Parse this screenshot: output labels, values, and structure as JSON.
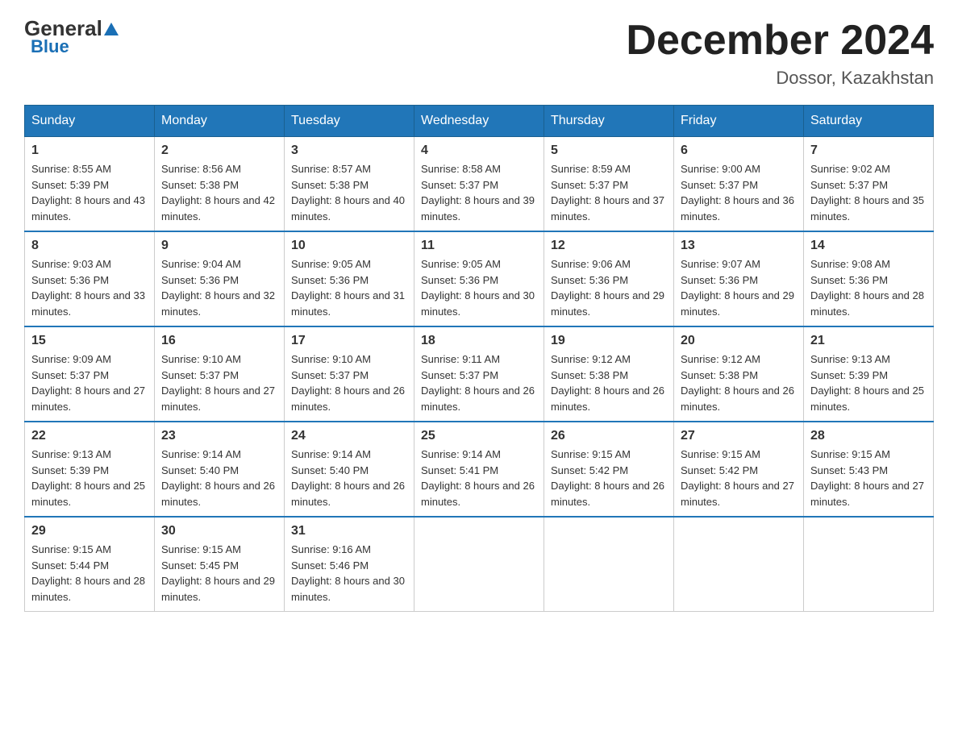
{
  "header": {
    "logo_general": "General",
    "logo_blue": "Blue",
    "month_title": "December 2024",
    "location": "Dossor, Kazakhstan"
  },
  "weekdays": [
    "Sunday",
    "Monday",
    "Tuesday",
    "Wednesday",
    "Thursday",
    "Friday",
    "Saturday"
  ],
  "weeks": [
    [
      {
        "day": "1",
        "sunrise": "8:55 AM",
        "sunset": "5:39 PM",
        "daylight": "8 hours and 43 minutes."
      },
      {
        "day": "2",
        "sunrise": "8:56 AM",
        "sunset": "5:38 PM",
        "daylight": "8 hours and 42 minutes."
      },
      {
        "day": "3",
        "sunrise": "8:57 AM",
        "sunset": "5:38 PM",
        "daylight": "8 hours and 40 minutes."
      },
      {
        "day": "4",
        "sunrise": "8:58 AM",
        "sunset": "5:37 PM",
        "daylight": "8 hours and 39 minutes."
      },
      {
        "day": "5",
        "sunrise": "8:59 AM",
        "sunset": "5:37 PM",
        "daylight": "8 hours and 37 minutes."
      },
      {
        "day": "6",
        "sunrise": "9:00 AM",
        "sunset": "5:37 PM",
        "daylight": "8 hours and 36 minutes."
      },
      {
        "day": "7",
        "sunrise": "9:02 AM",
        "sunset": "5:37 PM",
        "daylight": "8 hours and 35 minutes."
      }
    ],
    [
      {
        "day": "8",
        "sunrise": "9:03 AM",
        "sunset": "5:36 PM",
        "daylight": "8 hours and 33 minutes."
      },
      {
        "day": "9",
        "sunrise": "9:04 AM",
        "sunset": "5:36 PM",
        "daylight": "8 hours and 32 minutes."
      },
      {
        "day": "10",
        "sunrise": "9:05 AM",
        "sunset": "5:36 PM",
        "daylight": "8 hours and 31 minutes."
      },
      {
        "day": "11",
        "sunrise": "9:05 AM",
        "sunset": "5:36 PM",
        "daylight": "8 hours and 30 minutes."
      },
      {
        "day": "12",
        "sunrise": "9:06 AM",
        "sunset": "5:36 PM",
        "daylight": "8 hours and 29 minutes."
      },
      {
        "day": "13",
        "sunrise": "9:07 AM",
        "sunset": "5:36 PM",
        "daylight": "8 hours and 29 minutes."
      },
      {
        "day": "14",
        "sunrise": "9:08 AM",
        "sunset": "5:36 PM",
        "daylight": "8 hours and 28 minutes."
      }
    ],
    [
      {
        "day": "15",
        "sunrise": "9:09 AM",
        "sunset": "5:37 PM",
        "daylight": "8 hours and 27 minutes."
      },
      {
        "day": "16",
        "sunrise": "9:10 AM",
        "sunset": "5:37 PM",
        "daylight": "8 hours and 27 minutes."
      },
      {
        "day": "17",
        "sunrise": "9:10 AM",
        "sunset": "5:37 PM",
        "daylight": "8 hours and 26 minutes."
      },
      {
        "day": "18",
        "sunrise": "9:11 AM",
        "sunset": "5:37 PM",
        "daylight": "8 hours and 26 minutes."
      },
      {
        "day": "19",
        "sunrise": "9:12 AM",
        "sunset": "5:38 PM",
        "daylight": "8 hours and 26 minutes."
      },
      {
        "day": "20",
        "sunrise": "9:12 AM",
        "sunset": "5:38 PM",
        "daylight": "8 hours and 26 minutes."
      },
      {
        "day": "21",
        "sunrise": "9:13 AM",
        "sunset": "5:39 PM",
        "daylight": "8 hours and 25 minutes."
      }
    ],
    [
      {
        "day": "22",
        "sunrise": "9:13 AM",
        "sunset": "5:39 PM",
        "daylight": "8 hours and 25 minutes."
      },
      {
        "day": "23",
        "sunrise": "9:14 AM",
        "sunset": "5:40 PM",
        "daylight": "8 hours and 26 minutes."
      },
      {
        "day": "24",
        "sunrise": "9:14 AM",
        "sunset": "5:40 PM",
        "daylight": "8 hours and 26 minutes."
      },
      {
        "day": "25",
        "sunrise": "9:14 AM",
        "sunset": "5:41 PM",
        "daylight": "8 hours and 26 minutes."
      },
      {
        "day": "26",
        "sunrise": "9:15 AM",
        "sunset": "5:42 PM",
        "daylight": "8 hours and 26 minutes."
      },
      {
        "day": "27",
        "sunrise": "9:15 AM",
        "sunset": "5:42 PM",
        "daylight": "8 hours and 27 minutes."
      },
      {
        "day": "28",
        "sunrise": "9:15 AM",
        "sunset": "5:43 PM",
        "daylight": "8 hours and 27 minutes."
      }
    ],
    [
      {
        "day": "29",
        "sunrise": "9:15 AM",
        "sunset": "5:44 PM",
        "daylight": "8 hours and 28 minutes."
      },
      {
        "day": "30",
        "sunrise": "9:15 AM",
        "sunset": "5:45 PM",
        "daylight": "8 hours and 29 minutes."
      },
      {
        "day": "31",
        "sunrise": "9:16 AM",
        "sunset": "5:46 PM",
        "daylight": "8 hours and 30 minutes."
      },
      null,
      null,
      null,
      null
    ]
  ],
  "labels": {
    "sunrise": "Sunrise:",
    "sunset": "Sunset:",
    "daylight": "Daylight:"
  }
}
